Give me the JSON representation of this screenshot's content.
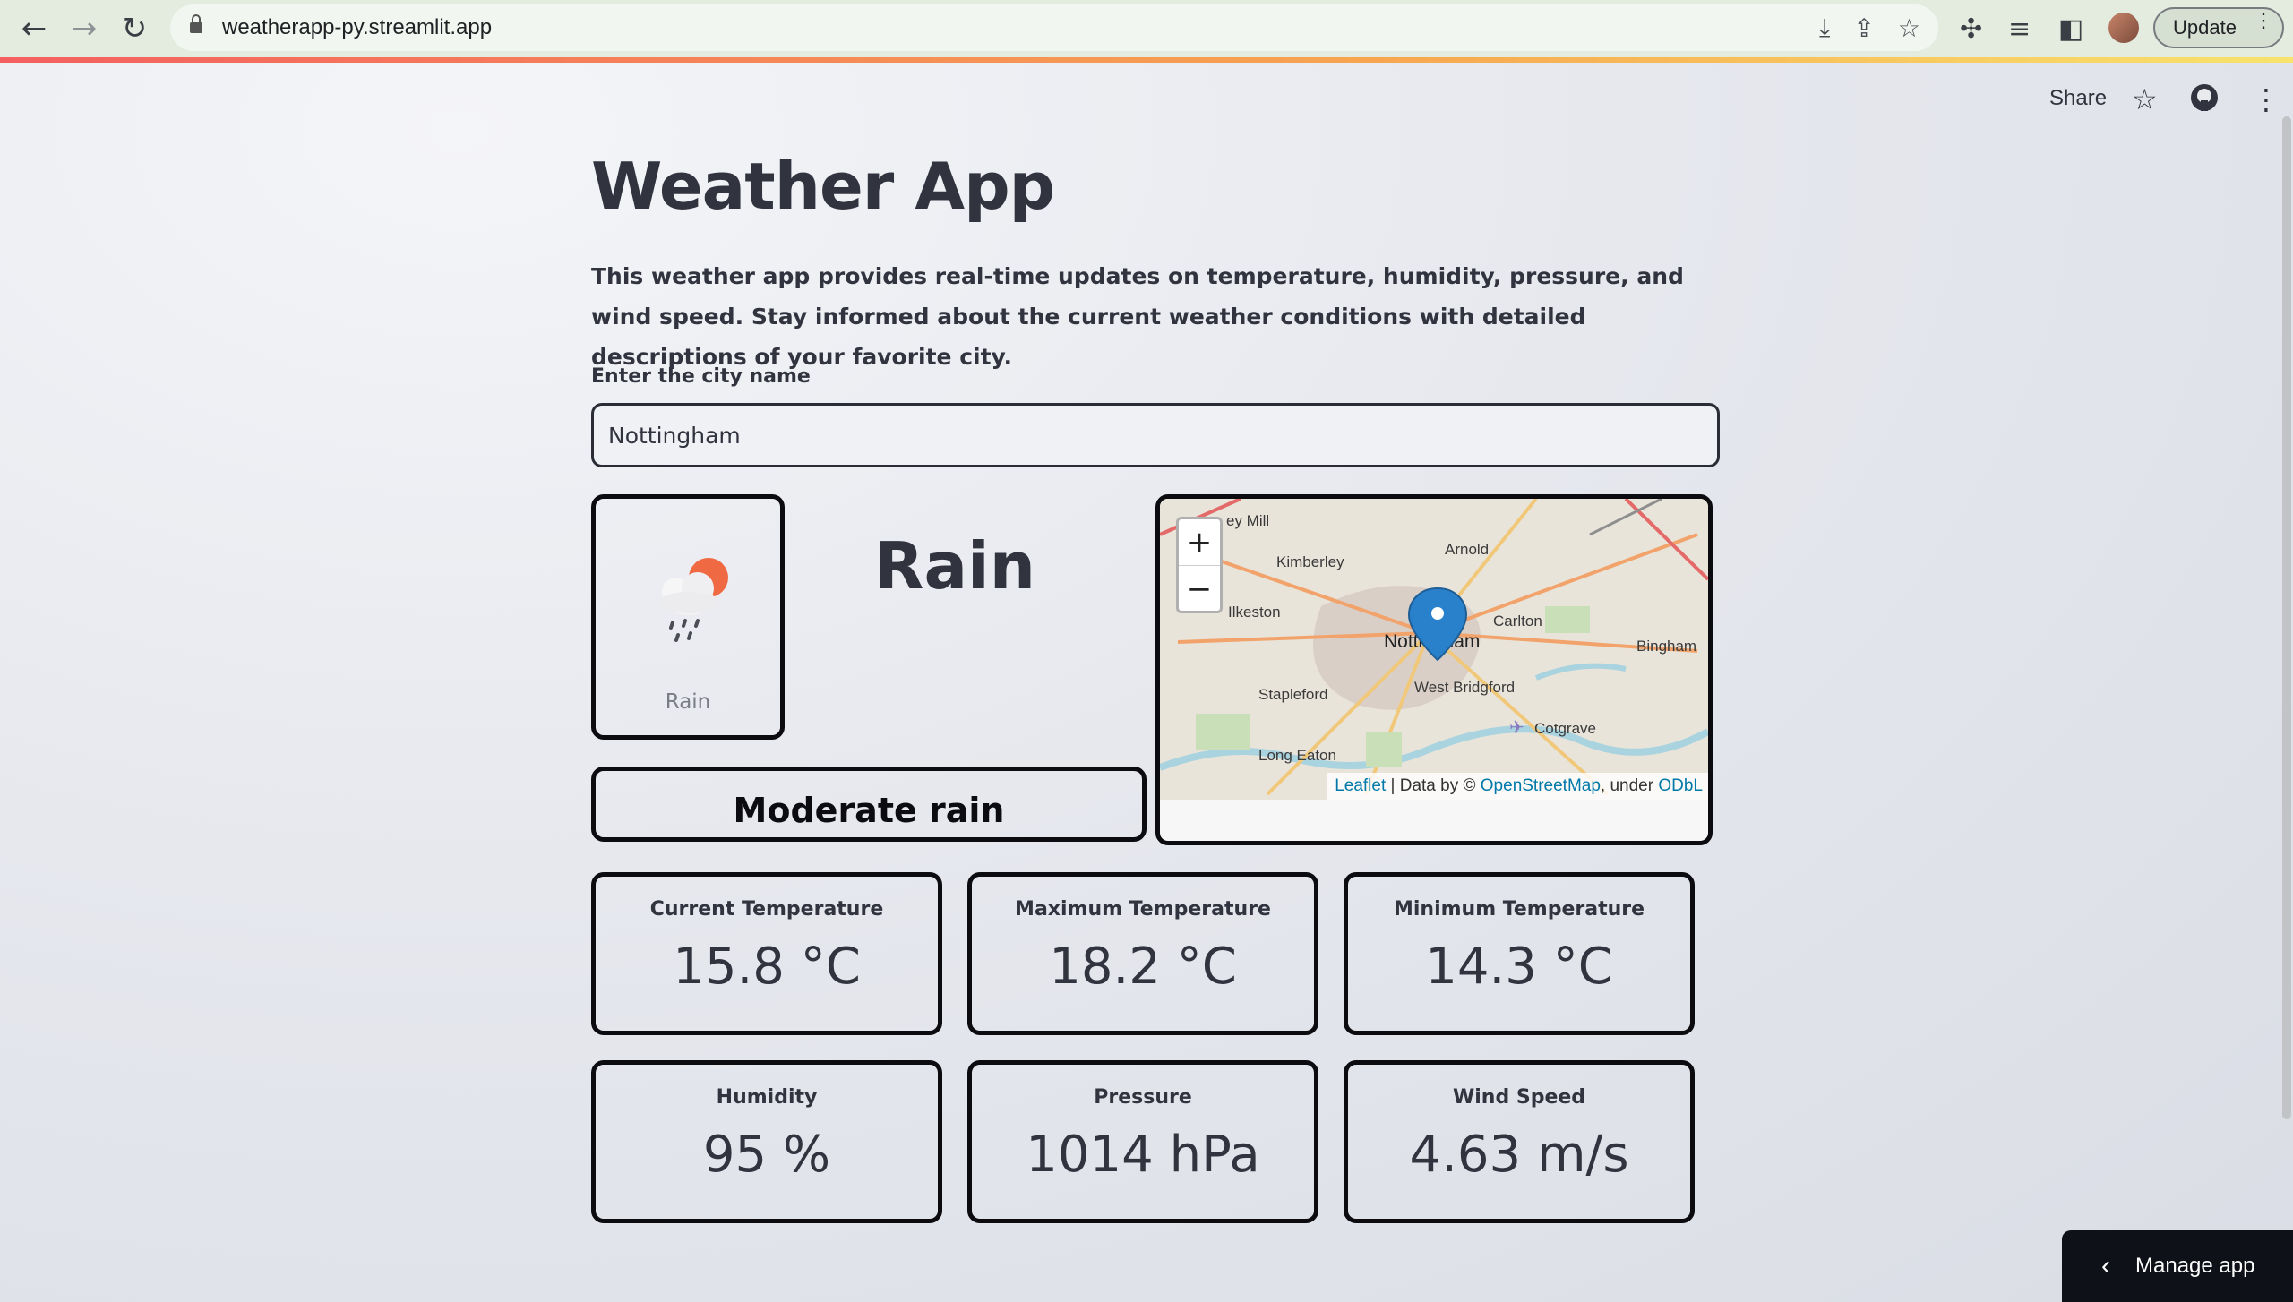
{
  "browser": {
    "url": "weatherapp-py.streamlit.app",
    "update_label": "Update"
  },
  "header": {
    "share_label": "Share"
  },
  "page": {
    "title": "Weather App",
    "description": "This weather app provides real-time updates on temperature, humidity, pressure, and wind speed. Stay informed about the current weather conditions with detailed descriptions of your favorite city.",
    "input_label": "Enter the city name",
    "city_value": "Nottingham"
  },
  "weather": {
    "icon": "rain-cloud-sun-icon",
    "icon_caption": "Rain",
    "condition": "Rain",
    "description": "Moderate rain"
  },
  "map": {
    "zoom_in": "+",
    "zoom_out": "−",
    "labels": [
      "Kimberley",
      "Arnold",
      "Ilkeston",
      "Nottingham",
      "Carlton",
      "Bingham",
      "Stapleford",
      "West Bridgford",
      "Cotgrave",
      "Long Eaton",
      "ey Mill"
    ],
    "attribution": {
      "leaflet": "Leaflet",
      "sep": " | Data by © ",
      "osm": "OpenStreetMap",
      "under": ", under ",
      "odbl": "ODbL"
    }
  },
  "metrics": [
    {
      "label": "Current Temperature",
      "value": "15.8 °C"
    },
    {
      "label": "Maximum Temperature",
      "value": "18.2 °C"
    },
    {
      "label": "Minimum Temperature",
      "value": "14.3 °C"
    },
    {
      "label": "Humidity",
      "value": "95 %"
    },
    {
      "label": "Pressure",
      "value": "1014 hPa"
    },
    {
      "label": "Wind Speed",
      "value": "4.63 m/s"
    }
  ],
  "footer": {
    "manage_label": "Manage app"
  },
  "colors": {
    "accent_gradient_start": "#f46060",
    "card_border": "#0b0b10",
    "text": "#31333f",
    "map_link": "#0078a8"
  }
}
